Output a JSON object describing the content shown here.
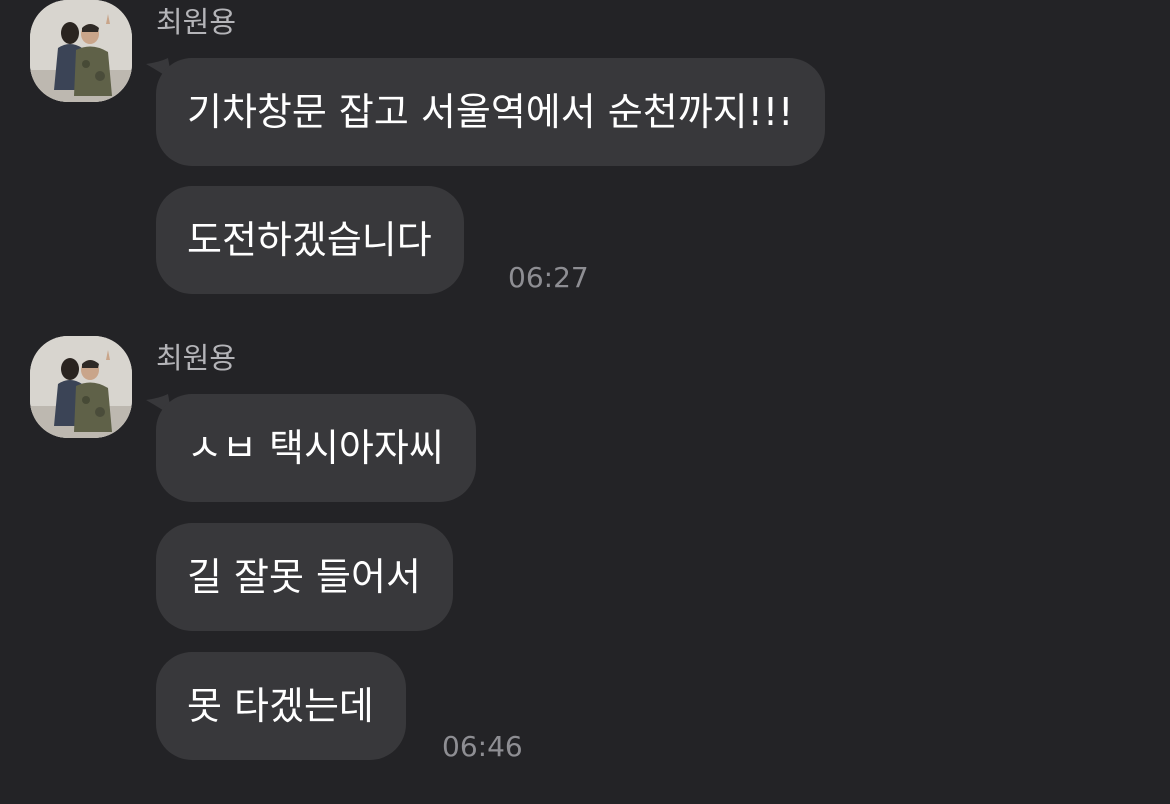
{
  "messages": [
    {
      "sender": "최원용",
      "bubbles": [
        "기차창문 잡고 서울역에서 순천까지!!!",
        "도전하겠습니다"
      ],
      "time": "06:27"
    },
    {
      "sender": "최원용",
      "bubbles": [
        "ㅅㅂ 택시아자씨",
        "길 잘못 들어서",
        "못 타겠는데"
      ],
      "time": "06:46"
    }
  ],
  "colors": {
    "background": "#232326",
    "bubble": "#38383b",
    "text": "#ffffff",
    "sender": "#b4b4b8",
    "time": "#8e8e93"
  }
}
